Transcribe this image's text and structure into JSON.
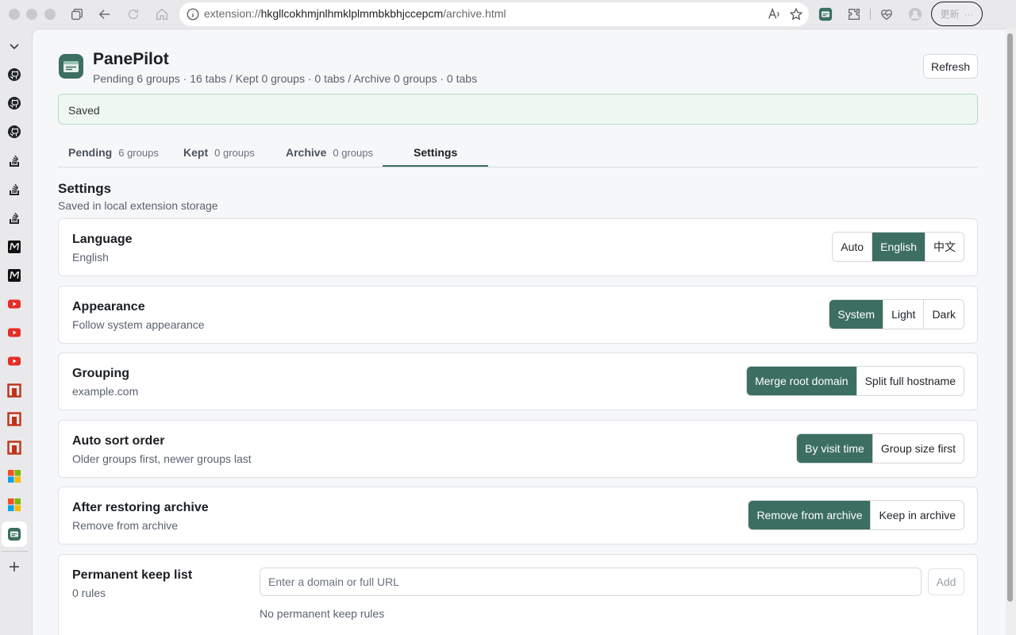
{
  "browser": {
    "url_prefix": "extension://",
    "url_host": "hkgllcokhmjnlhmklplmmbkbhjccepcm",
    "url_path": "/archive.html",
    "update_label": "更新",
    "update_more": "···"
  },
  "sidebar": {
    "items": [
      {
        "icon": "chevron-down-icon"
      },
      {
        "icon": "github-icon"
      },
      {
        "icon": "github-icon"
      },
      {
        "icon": "github-icon"
      },
      {
        "icon": "stackoverflow-icon"
      },
      {
        "icon": "stackoverflow-icon"
      },
      {
        "icon": "stackoverflow-icon"
      },
      {
        "icon": "medium-icon"
      },
      {
        "icon": "medium-icon"
      },
      {
        "icon": "youtube-icon"
      },
      {
        "icon": "youtube-icon"
      },
      {
        "icon": "youtube-icon"
      },
      {
        "icon": "openrouter-icon"
      },
      {
        "icon": "openrouter-icon"
      },
      {
        "icon": "openrouter-icon"
      },
      {
        "icon": "microsoft-icon"
      },
      {
        "icon": "microsoft-icon"
      },
      {
        "icon": "panepilot-icon"
      },
      {
        "icon": "plus-icon"
      }
    ]
  },
  "header": {
    "title": "PanePilot",
    "subtitle": "Pending 6 groups · 16 tabs / Kept 0 groups · 0 tabs / Archive 0 groups · 0 tabs",
    "refresh_label": "Refresh"
  },
  "banner": {
    "text": "Saved"
  },
  "tabs": [
    {
      "label": "Pending",
      "count": "6 groups"
    },
    {
      "label": "Kept",
      "count": "0 groups"
    },
    {
      "label": "Archive",
      "count": "0 groups"
    },
    {
      "label": "Settings",
      "count": ""
    }
  ],
  "settings": {
    "title": "Settings",
    "subtitle": "Saved in local extension storage",
    "language": {
      "title": "Language",
      "value": "English",
      "options": [
        "Auto",
        "English",
        "中文"
      ],
      "selected": "English"
    },
    "appearance": {
      "title": "Appearance",
      "value": "Follow system appearance",
      "options": [
        "System",
        "Light",
        "Dark"
      ],
      "selected": "System"
    },
    "grouping": {
      "title": "Grouping",
      "value": "example.com",
      "options": [
        "Merge root domain",
        "Split full hostname"
      ],
      "selected": "Merge root domain"
    },
    "sort": {
      "title": "Auto sort order",
      "value": "Older groups first, newer groups last",
      "options": [
        "By visit time",
        "Group size first"
      ],
      "selected": "By visit time"
    },
    "restore": {
      "title": "After restoring archive",
      "value": "Remove from archive",
      "options": [
        "Remove from archive",
        "Keep in archive"
      ],
      "selected": "Remove from archive"
    },
    "keep": {
      "title": "Permanent keep list",
      "count": "0 rules",
      "placeholder": "Enter a domain or full URL",
      "add_label": "Add",
      "empty_text": "No permanent keep rules"
    }
  },
  "colors": {
    "accent": "#3c6e62",
    "banner_bg": "#eef7f2",
    "banner_border": "#b7dcc7"
  }
}
